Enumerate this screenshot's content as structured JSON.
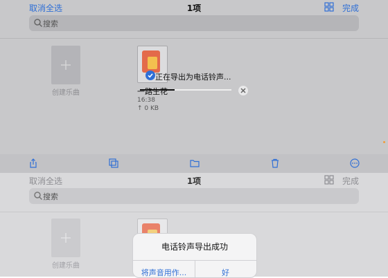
{
  "top": {
    "nav": {
      "cancel_select_all": "取消全选",
      "count": "1项",
      "done": "完成"
    },
    "search": {
      "placeholder": "搜索"
    },
    "new_song": {
      "label": "创建乐曲"
    },
    "song": {
      "name": "一路生花",
      "time": "16:38",
      "size": "↑ 0 KB"
    },
    "export": {
      "text": "正在导出为电话铃声...",
      "progress": 0.38
    }
  },
  "bottom": {
    "nav": {
      "cancel_select_all": "取消全选",
      "count": "1项",
      "done": "完成"
    },
    "search": {
      "placeholder": "搜索"
    },
    "new_song": {
      "label": "创建乐曲"
    },
    "dialog": {
      "title": "电话铃声导出成功",
      "btn_use": "将声音用作...",
      "btn_ok": "好"
    }
  },
  "colors": {
    "accent": "#2f6fd6",
    "orange_indicator": "#f29b3b"
  },
  "icons": [
    "grid-icon",
    "search-icon",
    "plus-icon",
    "share-icon",
    "duplicate-icon",
    "folder-icon",
    "trash-icon",
    "more-icon",
    "close-icon",
    "check-icon"
  ]
}
